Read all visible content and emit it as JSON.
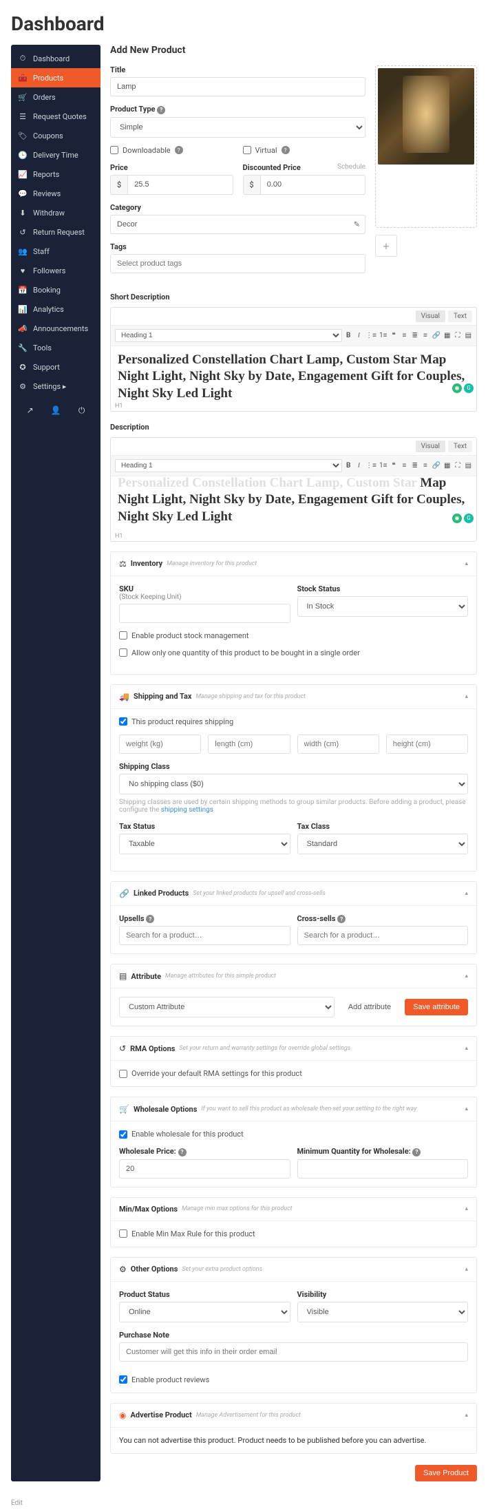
{
  "page_title": "Dashboard",
  "main_title": "Add New Product",
  "sidebar": {
    "items": [
      {
        "label": "Dashboard",
        "icon": "⏱"
      },
      {
        "label": "Products",
        "icon": "🧰",
        "active": true
      },
      {
        "label": "Orders",
        "icon": "🛒"
      },
      {
        "label": "Request Quotes",
        "icon": "☰"
      },
      {
        "label": "Coupons",
        "icon": "🏷"
      },
      {
        "label": "Delivery Time",
        "icon": "🕒"
      },
      {
        "label": "Reports",
        "icon": "📈"
      },
      {
        "label": "Reviews",
        "icon": "💬"
      },
      {
        "label": "Withdraw",
        "icon": "⬇"
      },
      {
        "label": "Return Request",
        "icon": "↺"
      },
      {
        "label": "Staff",
        "icon": "👥"
      },
      {
        "label": "Followers",
        "icon": "♥"
      },
      {
        "label": "Booking",
        "icon": "📅"
      },
      {
        "label": "Analytics",
        "icon": "📊"
      },
      {
        "label": "Announcements",
        "icon": "📣"
      },
      {
        "label": "Tools",
        "icon": "🔧"
      },
      {
        "label": "Support",
        "icon": "✪"
      },
      {
        "label": "Settings ▸",
        "icon": "⚙"
      }
    ]
  },
  "form": {
    "title_label": "Title",
    "title_value": "Lamp",
    "product_type_label": "Product Type",
    "product_type_value": "Simple",
    "downloadable_label": "Downloadable",
    "virtual_label": "Virtual",
    "price_label": "Price",
    "price_value": "25.5",
    "discounted_label": "Discounted Price",
    "discounted_value": "0.00",
    "schedule_label": "Schedule",
    "currency": "$",
    "category_label": "Category",
    "category_value": "Decor",
    "tags_label": "Tags",
    "tags_placeholder": "Select product tags",
    "short_desc_label": "Short Description",
    "desc_label": "Description",
    "editor_tabs": {
      "visual": "Visual",
      "text": "Text"
    },
    "heading_sel": "Heading 1",
    "short_desc_content": "Personalized Constellation Chart Lamp, Custom Star Map Night Light, Night Sky by Date, Engagement Gift",
    "short_desc_line2": "for Couples, Night Sky Led Light",
    "desc_content_top": "Personalized Constellation Chart Lamp, Custom Star",
    "desc_content": "Map Night Light, Night Sky by Date, Engagement Gift for Couples, Night Sky Led Light",
    "editor_foot": "H1"
  },
  "inventory": {
    "title": "Inventory",
    "hint": "Manage inventory for this product",
    "sku_label": "SKU",
    "sku_sub": "(Stock Keeping Unit)",
    "stock_status_label": "Stock Status",
    "stock_status_value": "In Stock",
    "enable_stock": "Enable product stock management",
    "one_qty": "Allow only one quantity of this product to be bought in a single order"
  },
  "shipping": {
    "title": "Shipping and Tax",
    "hint": "Manage shipping and tax for this product",
    "requires_label": "This product requires shipping",
    "weight_ph": "weight (kg)",
    "length_ph": "length (cm)",
    "width_ph": "width (cm)",
    "height_ph": "height (cm)",
    "class_label": "Shipping Class",
    "class_value": "No shipping class ($0)",
    "class_note": "Shipping classes are used by certain shipping methods to group similar products. Before adding a product, please configure the ",
    "class_link": "shipping settings",
    "tax_status_label": "Tax Status",
    "tax_status_value": "Taxable",
    "tax_class_label": "Tax Class",
    "tax_class_value": "Standard"
  },
  "linked": {
    "title": "Linked Products",
    "hint": "Set your linked products for upsell and cross-sells",
    "upsells_label": "Upsells",
    "cross_label": "Cross-sells",
    "search_ph": "Search for a product…"
  },
  "attribute": {
    "title": "Attribute",
    "hint": "Manage attributes for this simple product",
    "custom_value": "Custom Attribute",
    "add_btn": "Add attribute",
    "save_btn": "Save attribute"
  },
  "rma": {
    "title": "RMA Options",
    "hint": "Set your return and warranty settings for override global settings",
    "override_label": "Override your default RMA settings for this product"
  },
  "wholesale": {
    "title": "Wholesale Options",
    "hint": "If you want to sell this product as wholesale then set your setting to the right way",
    "enable_label": "Enable wholesale for this product",
    "price_label": "Wholesale Price:",
    "price_value": "20",
    "min_qty_label": "Minimum Quantity for Wholesale:"
  },
  "minmax": {
    "title": "Min/Max Options",
    "hint": "Manage min max options for this product",
    "enable_label": "Enable Min Max Rule for this product"
  },
  "other": {
    "title": "Other Options",
    "hint": "Set your extra product options",
    "status_label": "Product Status",
    "status_value": "Online",
    "visibility_label": "Visibility",
    "visibility_value": "Visible",
    "note_label": "Purchase Note",
    "note_ph": "Customer will get this info in their order email",
    "reviews_label": "Enable product reviews"
  },
  "advertise": {
    "title": "Advertise Product",
    "hint": "Manage Advertisement for this product",
    "msg": "You can not advertise this product. Product needs to be published before you can advertise."
  },
  "save_btn": "Save Product",
  "edit_link": "Edit"
}
